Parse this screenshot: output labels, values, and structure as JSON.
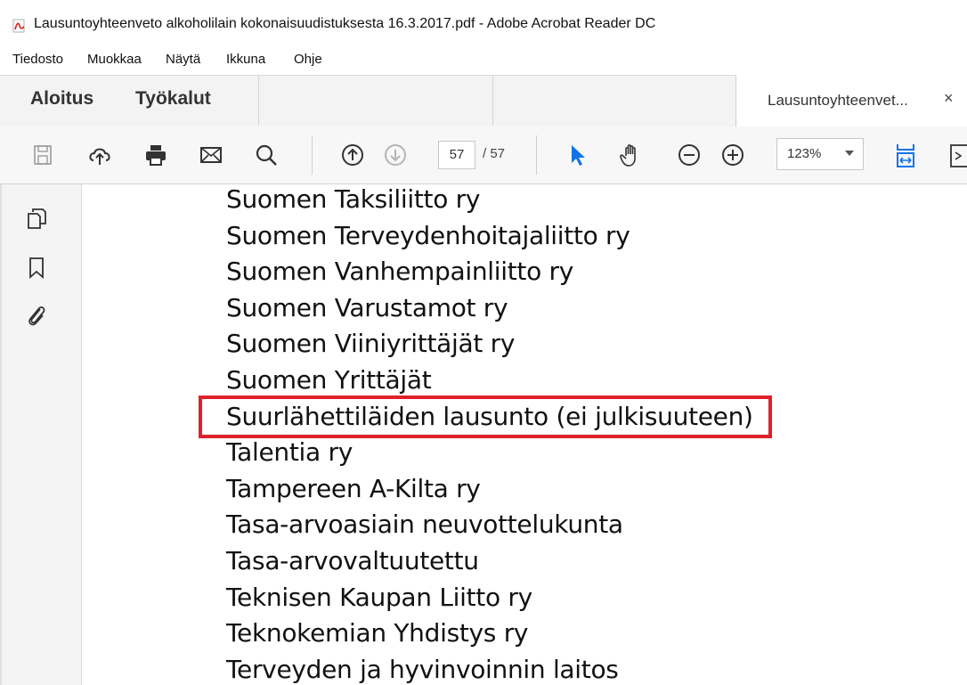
{
  "window": {
    "title": "Lausuntoyhteenveto alkoholilain kokonaisuudistuksesta 16.3.2017.pdf - Adobe Acrobat Reader DC",
    "icon": "pdf-file-icon"
  },
  "menu": {
    "items": [
      "Tiedosto",
      "Muokkaa",
      "Näytä",
      "Ikkuna",
      "Ohje"
    ]
  },
  "tabs": {
    "home": "Aloitus",
    "tools": "Työkalut",
    "document": "Lausuntoyhteenvet...",
    "close": "×"
  },
  "toolbar": {
    "current_page": "57",
    "total_pages": "/ 57",
    "zoom": "123%",
    "accent_color": "#1473e6"
  },
  "document": {
    "entries": [
      "Suomen Taksiliitto ry",
      "Suomen Terveydenhoitajaliitto ry",
      "Suomen Vanhempainliitto ry",
      "Suomen Varustamot ry",
      "Suomen Viiniyrittäjät ry",
      "Suomen Yrittäjät",
      "Suurlähettiläiden lausunto (ei julkisuuteen)",
      "Talentia ry",
      "Tampereen A-Kilta ry",
      "Tasa-arvoasiain neuvottelukunta",
      "Tasa-arvovaltuutettu",
      "Teknisen Kaupan Liitto ry",
      "Teknokemian Yhdistys ry",
      "Terveyden ja hyvinvoinnin laitos"
    ],
    "highlight_color": "#e0202a"
  }
}
